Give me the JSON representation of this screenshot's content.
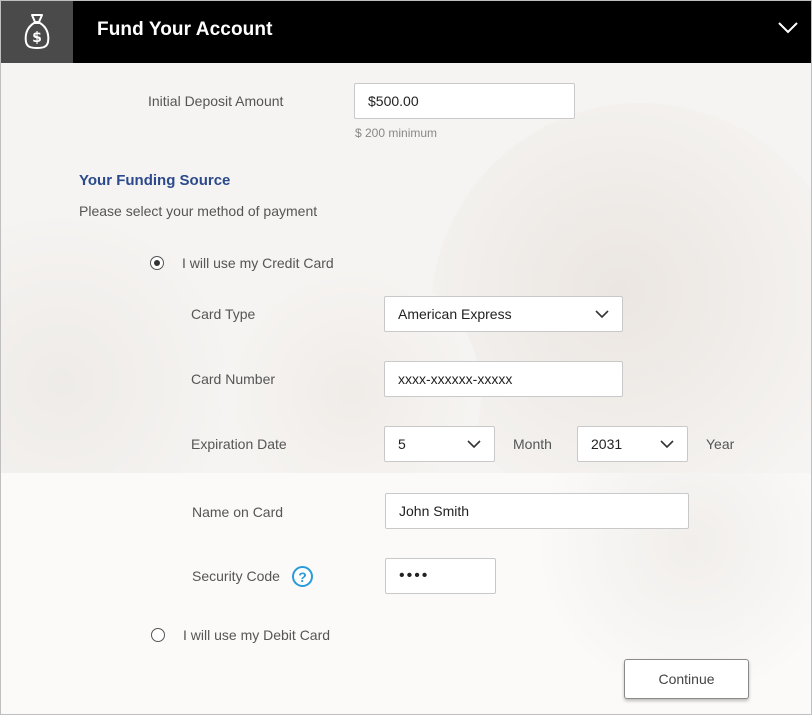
{
  "header": {
    "title": "Fund Your Account",
    "icon": "money-bag-icon",
    "toggle_icon": "chevron-down-icon"
  },
  "deposit": {
    "label": "Initial Deposit Amount",
    "value": "$500.00",
    "hint": "$ 200 minimum"
  },
  "funding": {
    "title": "Your Funding Source",
    "subtitle": "Please select your method of payment",
    "credit_option": "I will use my Credit Card",
    "debit_option": "I will use my Debit Card",
    "selected": "credit"
  },
  "card": {
    "type_label": "Card Type",
    "type_value": "American Express",
    "number_label": "Card Number",
    "number_value": "xxxx-xxxxxx-xxxxx",
    "expiry_label": "Expiration Date",
    "month_value": "5",
    "month_label": "Month",
    "year_value": "2031",
    "year_label": "Year",
    "name_label": "Name on Card",
    "name_value": "John Smith",
    "security_label": "Security Code",
    "security_value": "••••",
    "help_glyph": "?"
  },
  "actions": {
    "continue_label": "Continue"
  },
  "colors": {
    "header_bg": "#000000",
    "icon_box_bg": "#4a4a4a",
    "section_title": "#2b4a8b",
    "help_icon": "#2a9ad8"
  }
}
